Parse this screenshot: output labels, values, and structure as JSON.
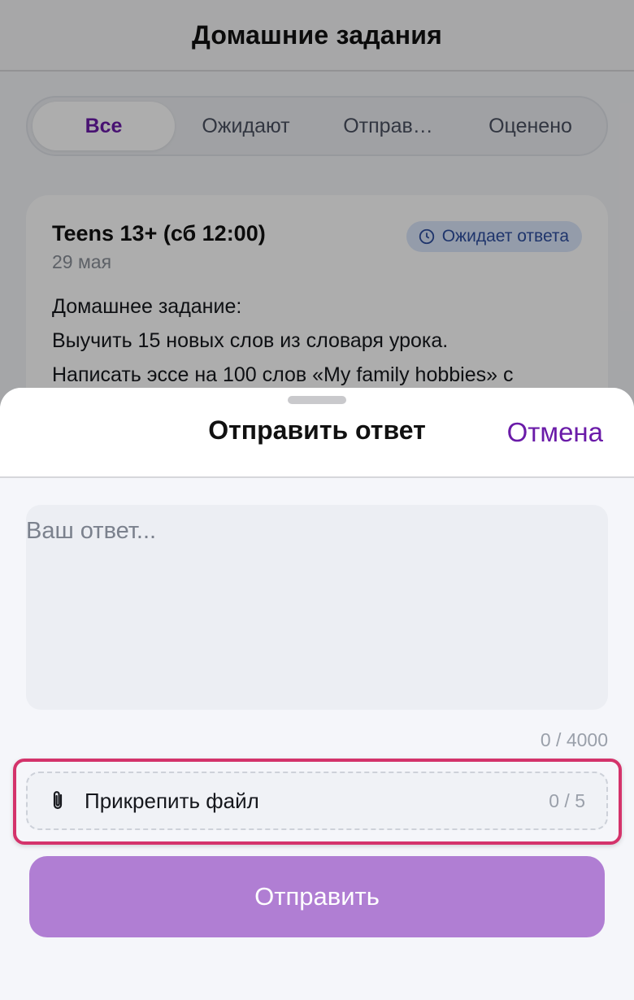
{
  "page": {
    "title": "Домашние задания"
  },
  "filters": {
    "tabs": [
      {
        "label": "Все",
        "active": true
      },
      {
        "label": "Ожидают",
        "active": false
      },
      {
        "label": "Отправ…",
        "active": false
      },
      {
        "label": "Оценено",
        "active": false
      }
    ]
  },
  "homework": {
    "title": "Teens 13+ (сб 12:00)",
    "date": "29 мая",
    "status": "Ожидает ответа",
    "status_icon": "clock-icon",
    "lines": [
      "Домашнее задание:",
      "Выучить 15 новых слов из словаря урока.",
      "Написать эссе на 100 слов «My family hobbies» с"
    ]
  },
  "sheet": {
    "title": "Отправить ответ",
    "cancel_label": "Отмена",
    "answer_placeholder": "Ваш ответ...",
    "answer_value": "",
    "char_counter": "0 / 4000",
    "attach_label": "Прикрепить файл",
    "attach_icon": "paperclip-icon",
    "attach_counter": "0 / 5",
    "submit_label": "Отправить"
  },
  "colors": {
    "accent": "#6a1ba8",
    "submit_disabled": "#b07ed3",
    "highlight": "#d4336b",
    "status_bg": "#dbe6fb",
    "status_text": "#2e4fa0"
  }
}
